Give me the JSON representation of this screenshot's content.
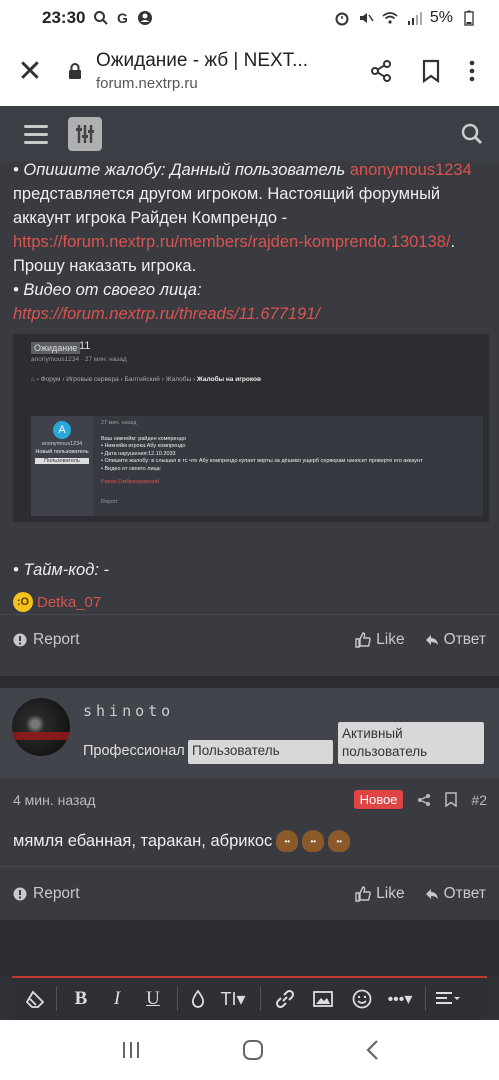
{
  "status_bar": {
    "time": "23:30",
    "battery": "5%"
  },
  "browser": {
    "title": "Ожидание - жб | NEXT...",
    "url": "forum.nextrp.ru"
  },
  "post1": {
    "line_cut": "• Опишите жалобу: Данный пользователь ",
    "line_cut_red": "anonymous1234",
    "text1": "представляется другом игроком. Настоящий форумный аккаунт игрока Райден Компрендо - ",
    "link1": "https://forum.nextrp.ru/members/rajden-komprendo.130138/",
    "text1_end": ".",
    "text2": "Прошу наказать игрока.",
    "video_label": "• Видео от своего лица:",
    "video_link": "https://forum.nextrp.ru/threads/11.677191/",
    "timecode": "• Тайм-код: -",
    "reaction_user": "Detka_07",
    "report": "Report",
    "like": "Like",
    "reply": "Ответ"
  },
  "screenshot": {
    "badge": "Ожидание",
    "number": "11",
    "meta": "anonymous1234 · 27 мин. назад",
    "crumbs": "⌂ › Форум › Игровые сервера › Балтийский › Жалобы ›",
    "crumbs_bold": "Жалобы на игроков",
    "user": "anonymous1234",
    "user_title": "Новый пользователь",
    "user_btn": "Пользователь",
    "time": "27 мин. назад",
    "lines": [
      "Ваш никнейм: райден компрендо",
      "• Никнейм игрока:Абу компрендо",
      "• Дата нарушения:12.10.2033",
      "• Опишите жалобу: в слышал в тс что Абу компрендо купает вирты за дёшево ущерб серверам наносит проверте его аккаунт",
      "• Видео от своего лица:"
    ],
    "sig": "Раиан Омбрандовский",
    "report": "Report"
  },
  "post2": {
    "username": "shinoto",
    "rank": "Профессионал",
    "badge1": "Пользователь",
    "badge2": "Активный пользователь",
    "time": "4 мин. назад",
    "new_label": "Новое",
    "number": "#2",
    "text": "мямля ебанная, таракан, абрикос",
    "report": "Report",
    "like": "Like",
    "reply": "Ответ"
  },
  "editor": {
    "buttons": [
      "eraser-icon",
      "bold",
      "italic",
      "underline",
      "color",
      "text-size",
      "link",
      "image",
      "smilie",
      "more",
      "align"
    ]
  }
}
